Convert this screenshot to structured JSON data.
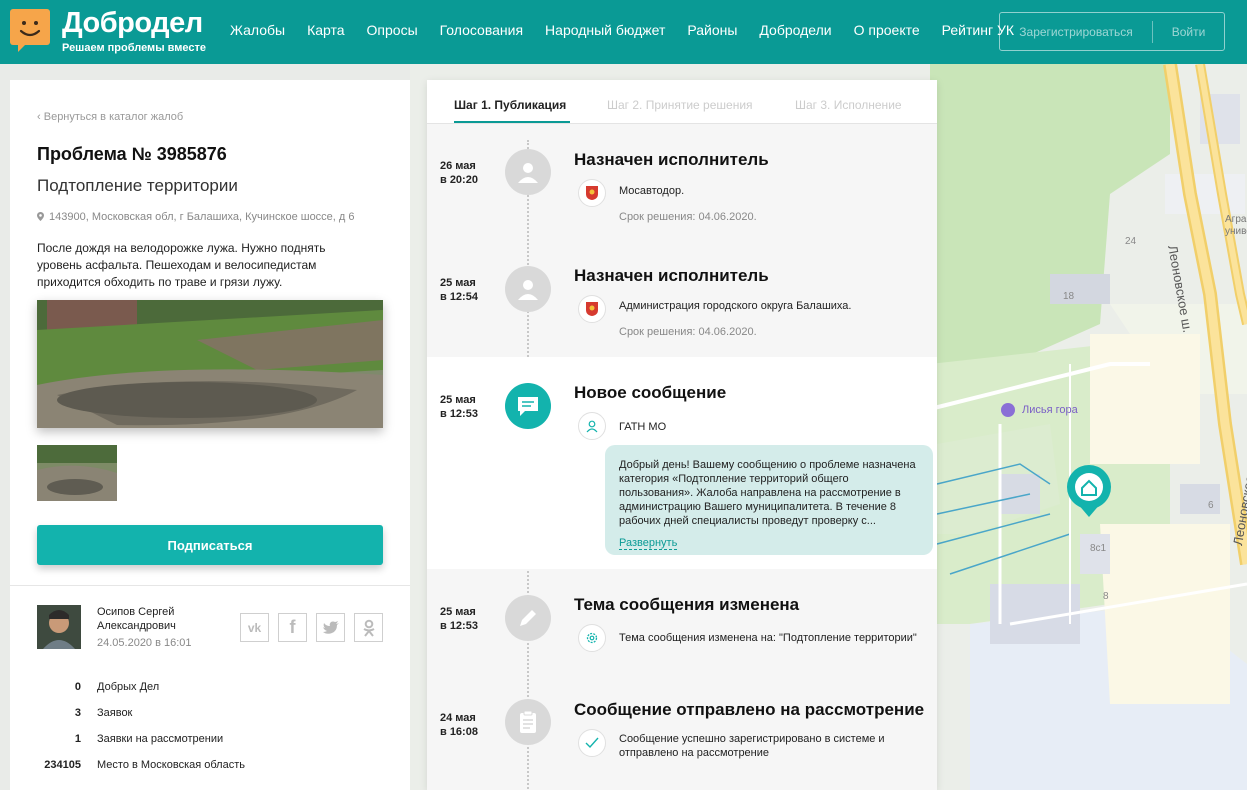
{
  "header": {
    "logo_title": "Добродел",
    "logo_sub": "Решаем проблемы вместе",
    "nav": [
      "Жалобы",
      "Карта",
      "Опросы",
      "Голосования",
      "Народный бюджет",
      "Районы",
      "Добродели",
      "О проекте",
      "Рейтинг УК"
    ],
    "register_label": "Зарегистрироваться",
    "login_label": "Войти"
  },
  "problem": {
    "back_link": "Вернуться в каталог жалоб",
    "title": "Проблема № 3985876",
    "category": "Подтопление территории",
    "address": "143900, Московская обл, г Балашиха, Кучинское шоссе, д 6",
    "description": "После дождя на велодорожке лужа. Нужно поднять уровень асфальта. Пешеходам и велосипедистам приходится обходить по траве и грязи лужу.",
    "subscribe_label": "Подписаться"
  },
  "author": {
    "name": "Осипов Сергей Александрович",
    "date": "24.05.2020 в 16:01",
    "social": [
      "vk",
      "f",
      "tw",
      "ok"
    ],
    "stats": [
      {
        "num": "0",
        "label": "Добрых Дел"
      },
      {
        "num": "3",
        "label": "Заявок"
      },
      {
        "num": "1",
        "label": "Заявки на рассмотрении"
      },
      {
        "num": "234105",
        "label": "Место в Московская область"
      }
    ]
  },
  "tabs": [
    {
      "label": "Шаг 1. Публикация",
      "active": true
    },
    {
      "label": "Шаг 2. Принятие решения",
      "active": false
    },
    {
      "label": "Шаг 3. Исполнение",
      "active": false
    }
  ],
  "events": [
    {
      "date1": "26 мая",
      "date2": "в 20:20",
      "title": "Назначен исполнитель",
      "text": "Мосавтодор.",
      "sub": "Срок решения: 04.06.2020."
    },
    {
      "date1": "25 мая",
      "date2": "в 12:54",
      "title": "Назначен исполнитель",
      "text": "Администрация городского округа Балашиха.",
      "sub": "Срок решения: 04.06.2020."
    },
    {
      "date1": "25 мая",
      "date2": "в 12:53",
      "title": "Новое сообщение",
      "text": "ГАТН МО",
      "message": "Добрый день! Вашему сообщению о проблеме назначена категория «Подтопление территорий общего пользования». Жалоба направлена на рассмотрение в администрацию Вашего муниципалитета. В течение 8 рабочих дней специалисты проведут проверку с...",
      "expand": "Развернуть"
    },
    {
      "date1": "25 мая",
      "date2": "в 12:53",
      "title": "Тема сообщения изменена",
      "text": "Тема сообщения изменена на: \"Подтопление территории\""
    },
    {
      "date1": "24 мая",
      "date2": "в 16:08",
      "title": "Сообщение отправлено на рассмотрение",
      "text": "Сообщение успешно зарегистрировано в системе и отправлено на рассмотрение"
    }
  ],
  "map": {
    "street1": "Леоновское ш.",
    "street2": "Леоновское ш",
    "poi": "Лисья гора",
    "agro1": "Аграр",
    "agro2": "универ",
    "numbers": [
      "24",
      "18",
      "6",
      "8с1",
      "8"
    ]
  },
  "colors": {
    "brand": "#0a9a95",
    "button": "#13b3ad",
    "bubble": "#d4ecea"
  }
}
